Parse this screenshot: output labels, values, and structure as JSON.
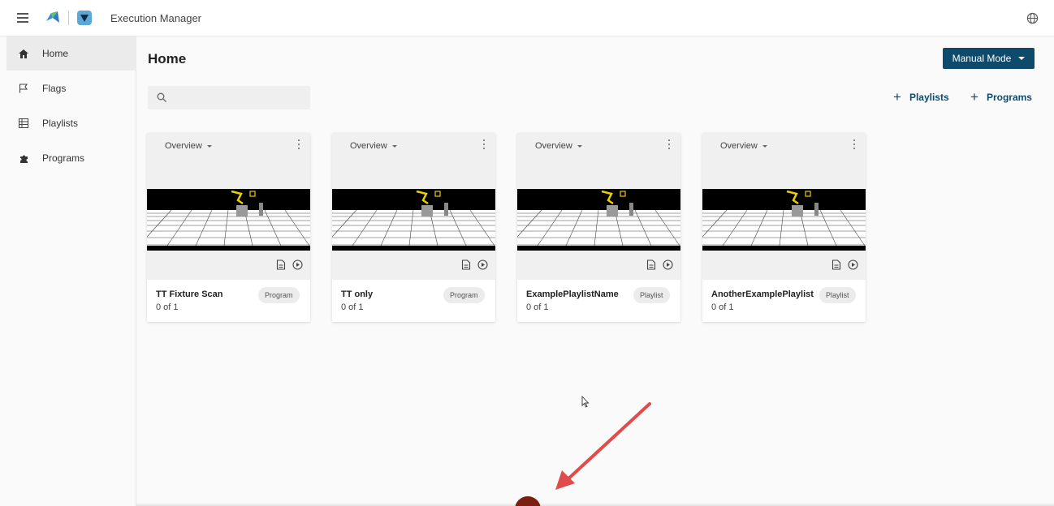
{
  "app": {
    "title": "Execution Manager",
    "menu_icon": "hamburger-icon",
    "globe_icon": "globe-icon"
  },
  "sidebar": {
    "items": [
      {
        "label": "Home",
        "icon": "home-icon",
        "active": true
      },
      {
        "label": "Flags",
        "icon": "flag-icon",
        "active": false
      },
      {
        "label": "Playlists",
        "icon": "playlist-icon",
        "active": false
      },
      {
        "label": "Programs",
        "icon": "puzzle-icon",
        "active": false
      }
    ]
  },
  "main": {
    "title": "Home",
    "mode_button": "Manual Mode",
    "search_placeholder": "",
    "add_playlists": "Playlists",
    "add_programs": "Programs"
  },
  "cards": [
    {
      "view": "Overview",
      "name": "TT Fixture Scan",
      "count": "0 of 1",
      "badge": "Program"
    },
    {
      "view": "Overview",
      "name": "TT only",
      "count": "0 of 1",
      "badge": "Program"
    },
    {
      "view": "Overview",
      "name": "ExamplePlaylistName",
      "count": "0 of 1",
      "badge": "Playlist"
    },
    {
      "view": "Overview",
      "name": "AnotherExamplePlaylist",
      "count": "0 of 1",
      "badge": "Playlist"
    }
  ],
  "colors": {
    "accent": "#0d4a6b",
    "annotation_arrow": "#e04b4b"
  }
}
